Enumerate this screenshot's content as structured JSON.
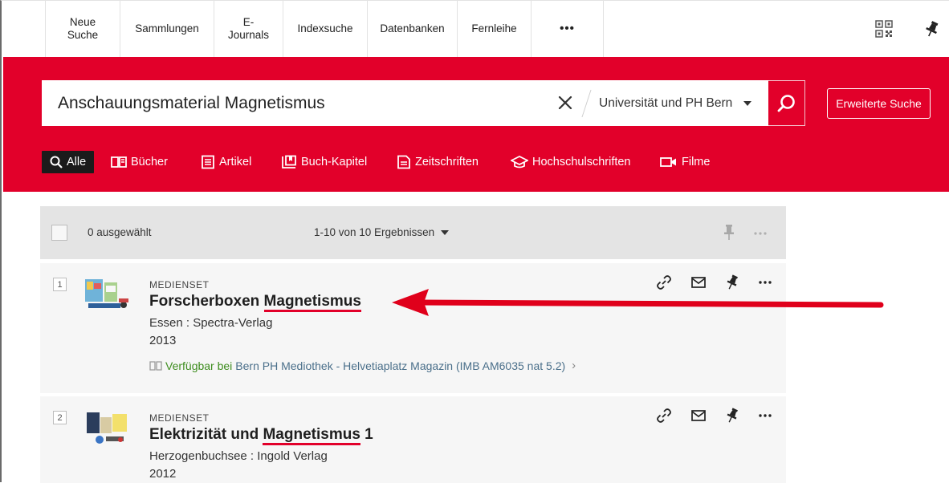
{
  "nav": {
    "items": [
      {
        "label": "Neue\nSuche"
      },
      {
        "label": "Sammlungen"
      },
      {
        "label": "E-\nJournals"
      },
      {
        "label": "Indexsuche"
      },
      {
        "label": "Datenbanken"
      },
      {
        "label": "Fernleihe"
      },
      {
        "label": "•••"
      }
    ],
    "icons": [
      "qr-code-icon",
      "pin-icon"
    ]
  },
  "search": {
    "query": "Anschauungsmaterial Magnetismus",
    "scope": "Universität und PH Bern",
    "advanced_label": "Erweiterte Suche"
  },
  "filters": [
    {
      "label": "Alle",
      "icon": "search-icon",
      "active": true
    },
    {
      "label": "Bücher",
      "icon": "book-icon"
    },
    {
      "label": "Artikel",
      "icon": "article-icon"
    },
    {
      "label": "Buch-Kapitel",
      "icon": "book-chapter-icon"
    },
    {
      "label": "Zeitschriften",
      "icon": "journal-icon"
    },
    {
      "label": "Hochschulschriften",
      "icon": "graduation-cap-icon"
    },
    {
      "label": "Filme",
      "icon": "video-camera-icon"
    }
  ],
  "toolbar": {
    "selected": "0 ausgewählt",
    "results": "1-10 von 10 Ergebnissen"
  },
  "results": [
    {
      "number": "1",
      "type": "MEDIENSET",
      "title_prefix": "Forscherboxen ",
      "title_highlight": "Magnetismus",
      "title_suffix": "",
      "publisher": "Essen : Spectra-Verlag",
      "year": "2013",
      "availability_status": "Verfügbar bei",
      "availability_location": "Bern PH Mediothek - Helvetiaplatz  Magazin (IMB AM6035 nat 5.2)",
      "chevron": "›"
    },
    {
      "number": "2",
      "type": "MEDIENSET",
      "title_prefix": "Elektrizität und ",
      "title_highlight": "Magnetismus",
      "title_suffix": " 1",
      "publisher": "Herzogenbuchsee : Ingold Verlag",
      "year": "2012"
    }
  ],
  "colors": {
    "brand_red": "#e2002a",
    "available_green": "#3e8d1f",
    "link_blue": "#4a6f8a",
    "annotation_red": "#e0001b"
  },
  "result_action_icons": [
    "link-icon",
    "email-icon",
    "pin-icon",
    "more-icon"
  ]
}
